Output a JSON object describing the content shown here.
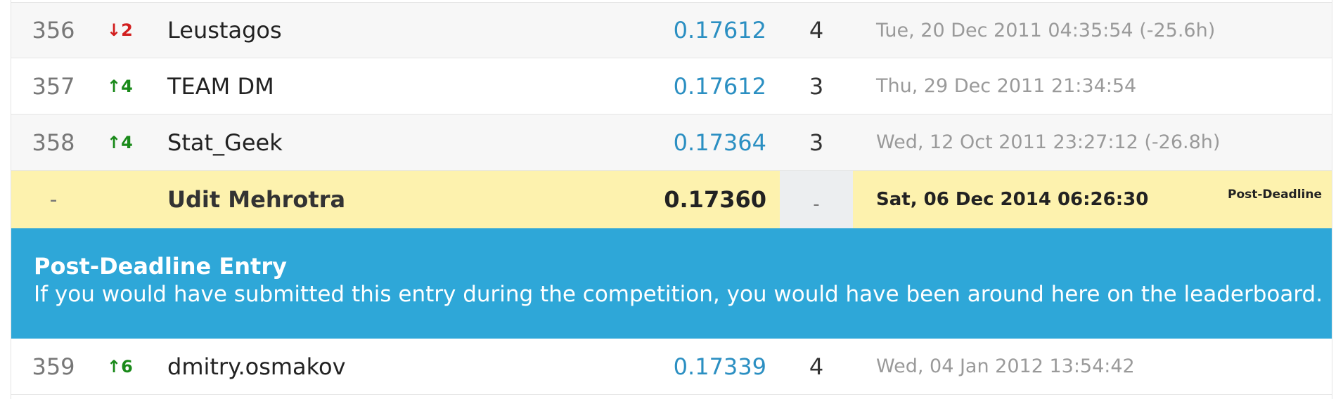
{
  "rows_before": [
    {
      "rank": "356",
      "delta": "↓2",
      "direction": "down",
      "team": "Leustagos",
      "score": "0.17612",
      "entries": "4",
      "last": "Tue, 20 Dec 2011 04:35:54 (-25.6h)"
    },
    {
      "rank": "357",
      "delta": "↑4",
      "direction": "up",
      "team": "TEAM DM",
      "score": "0.17612",
      "entries": "3",
      "last": "Thu, 29 Dec 2011 21:34:54"
    },
    {
      "rank": "358",
      "delta": "↑4",
      "direction": "up",
      "team": "Stat_Geek",
      "score": "0.17364",
      "entries": "3",
      "last": "Wed, 12 Oct 2011 23:27:12 (-26.8h)"
    }
  ],
  "post_deadline_row": {
    "rank": "-",
    "team": "Udit Mehrotra",
    "score": "0.17360",
    "entries": "-",
    "last": "Sat, 06 Dec 2014 06:26:30",
    "tag": "Post-Deadline"
  },
  "notice": {
    "title": "Post-Deadline Entry",
    "body": "If you would have submitted this entry during the competition, you would have been around here on the leaderboard."
  },
  "rows_after": [
    {
      "rank": "359",
      "delta": "↑6",
      "direction": "up",
      "team": "dmitry.osmakov",
      "score": "0.17339",
      "entries": "4",
      "last": "Wed, 04 Jan 2012 13:54:42"
    }
  ],
  "colors": {
    "score_link": "#2b8fc2",
    "delta_up": "#1a8a1a",
    "delta_down": "#d21f1f",
    "highlight_row": "#fdf2ae",
    "notice_bg": "#2ea7d8"
  }
}
